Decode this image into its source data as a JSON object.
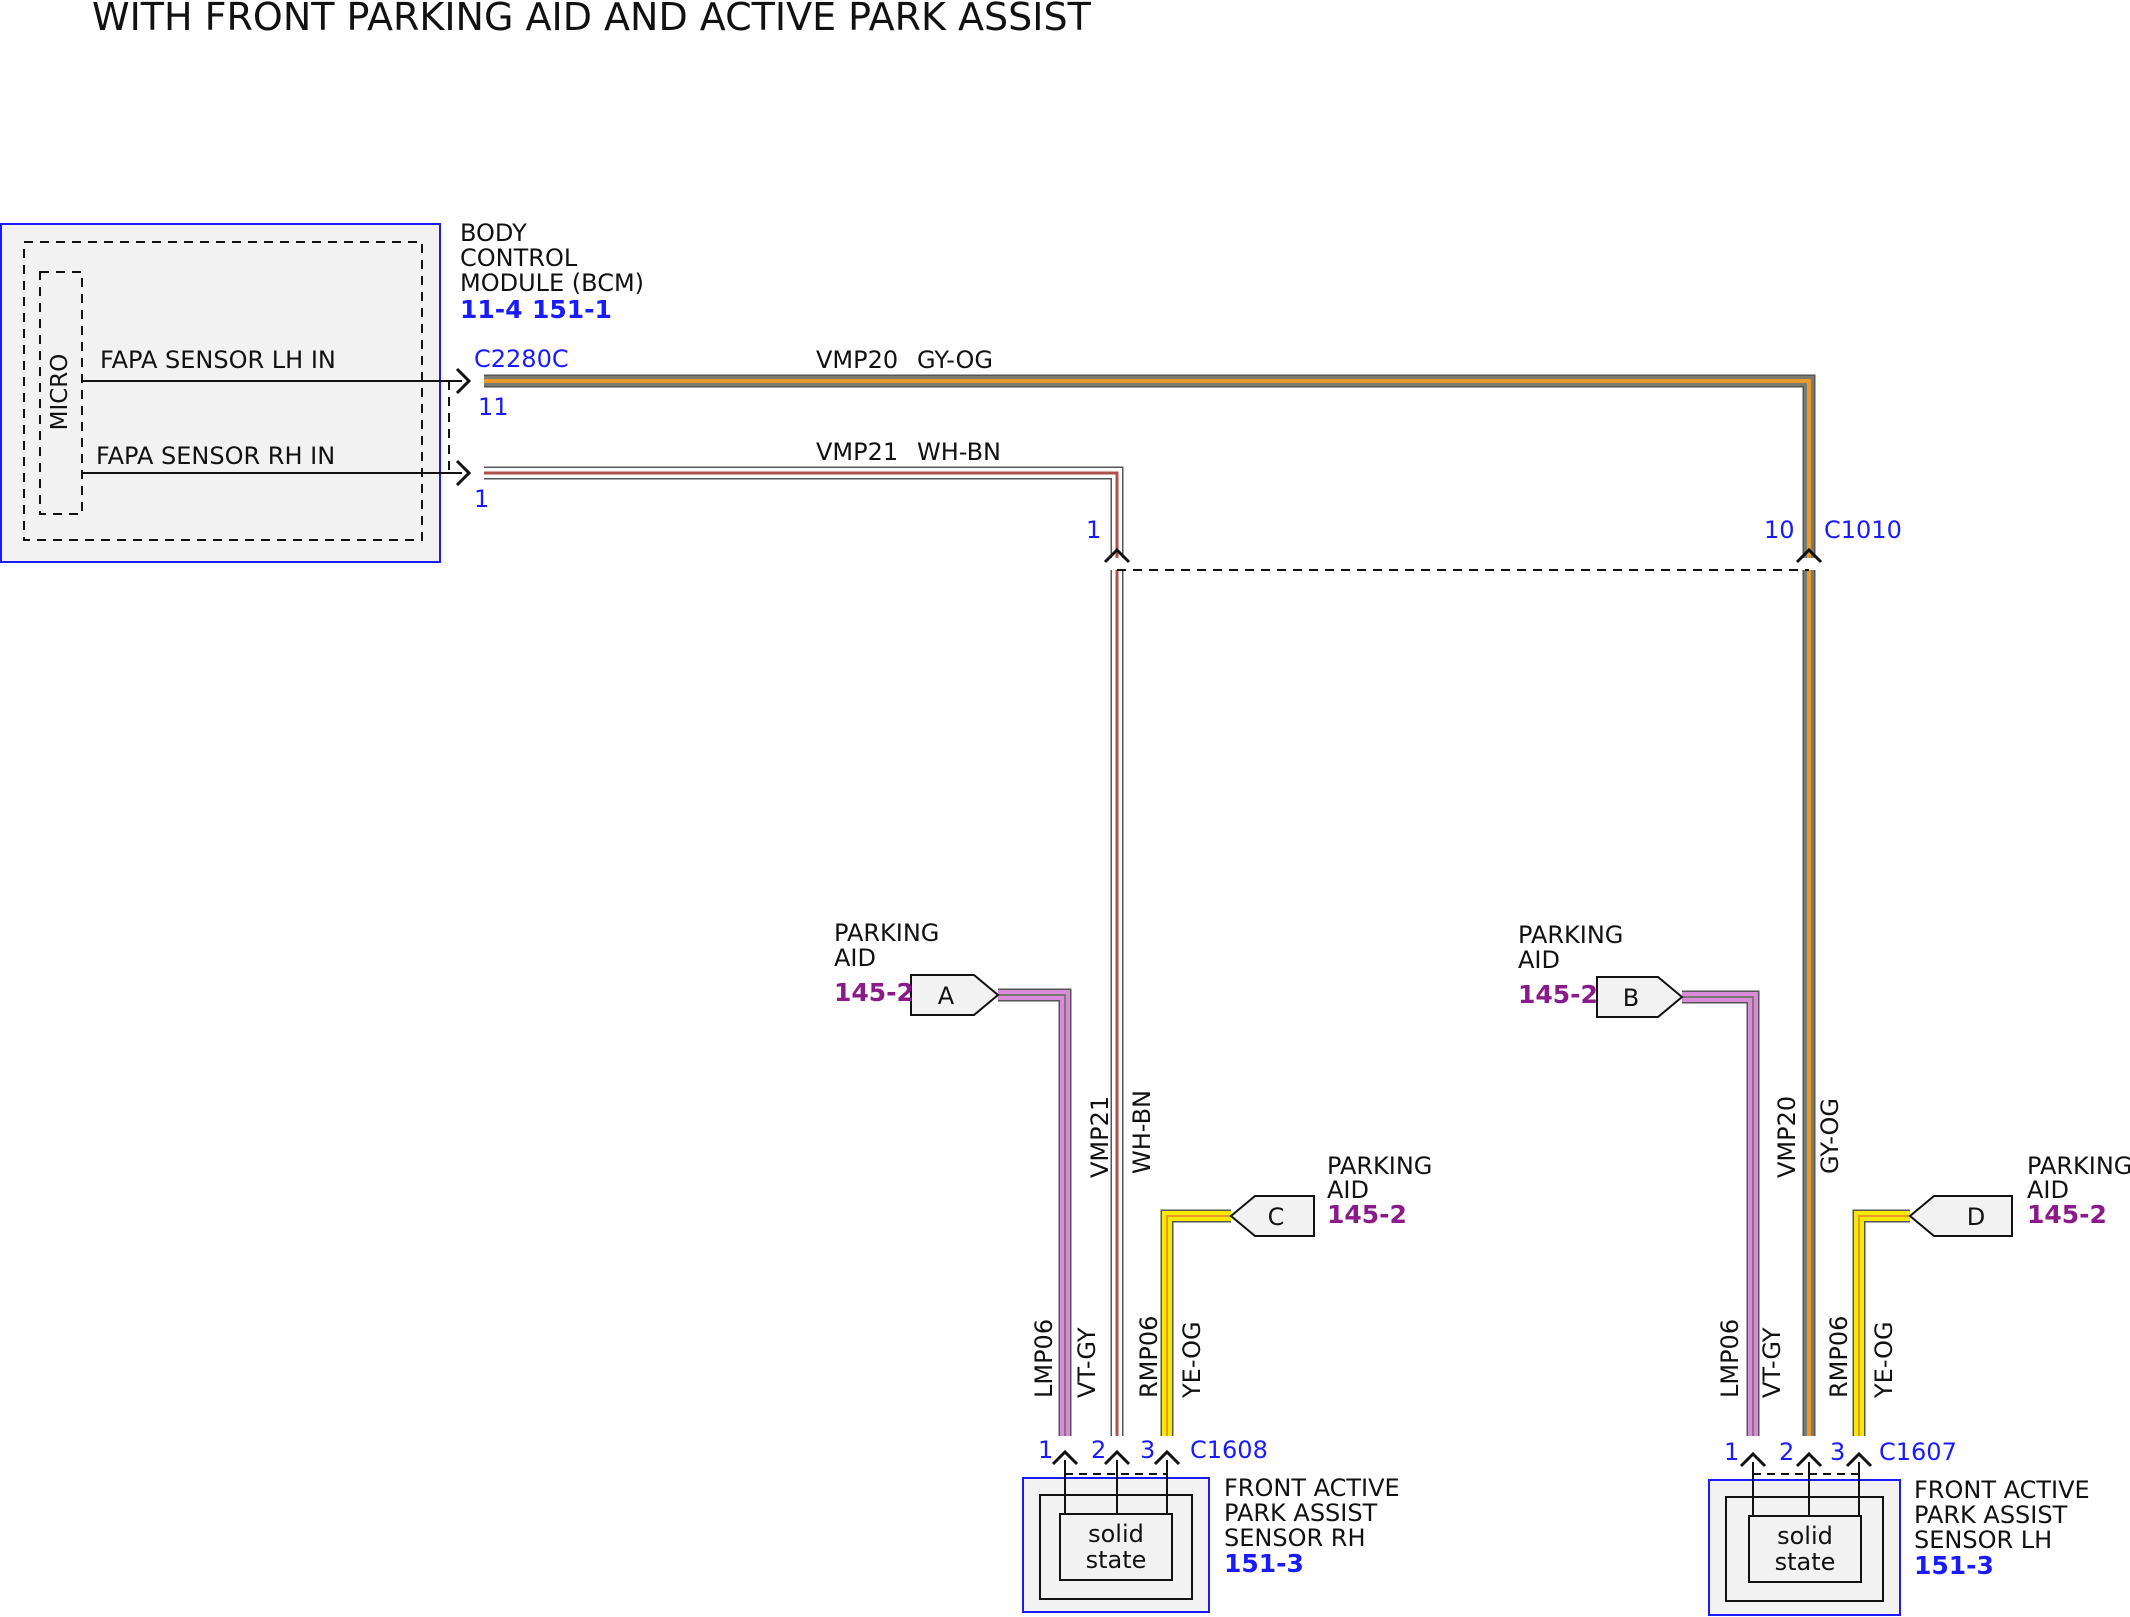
{
  "title": "WITH FRONT PARKING AID AND ACTIVE PARK ASSIST",
  "colors": {
    "module_border": "#1a1aff",
    "module_fill": "#f2f2f2",
    "ref_blue": "#1a1aff",
    "ref_purple": "#8a1a8a",
    "wire_gy": "#7a7a72",
    "wire_og": "#e89a2a",
    "wire_wh": "#ffffff",
    "wire_bn": "#b0504a",
    "wire_vt": "#d98ad9",
    "wire_ye": "#f5ea00"
  },
  "bcm": {
    "name_line1": "BODY",
    "name_line2": "CONTROL",
    "name_line3": "MODULE (BCM)",
    "ref1": "11-4",
    "ref2": "151-1",
    "micro_label": "MICRO",
    "pin_lh_label": "FAPA SENSOR LH IN",
    "pin_rh_label": "FAPA SENSOR RH IN",
    "connector": "C2280C",
    "pin_lh": "11",
    "pin_rh": "1"
  },
  "wires": {
    "vmp20": {
      "circuit": "VMP20",
      "color": "GY-OG"
    },
    "vmp21": {
      "circuit": "VMP21",
      "color": "WH-BN"
    },
    "lmp06": {
      "circuit": "LMP06",
      "color": "VT-GY"
    },
    "rmp06": {
      "circuit": "RMP06",
      "color": "YE-OG"
    }
  },
  "inline_connector": {
    "name": "C1010",
    "pin_vmp21": "1",
    "pin_vmp20": "10"
  },
  "parking_aid_refs": [
    {
      "id": "A",
      "line1": "PARKING",
      "line2": "AID",
      "ref": "145-2"
    },
    {
      "id": "B",
      "line1": "PARKING",
      "line2": "AID",
      "ref": "145-2"
    },
    {
      "id": "C",
      "line1": "PARKING",
      "line2": "AID",
      "ref": "145-2"
    },
    {
      "id": "D",
      "line1": "PARKING",
      "line2": "AID",
      "ref": "145-2"
    }
  ],
  "sensor_rh": {
    "connector": "C1608",
    "pins": [
      "1",
      "2",
      "3"
    ],
    "line1": "FRONT ACTIVE",
    "line2": "PARK ASSIST",
    "line3": "SENSOR RH",
    "ref": "151-3",
    "inner_line1": "solid",
    "inner_line2": "state"
  },
  "sensor_lh": {
    "connector": "C1607",
    "pins": [
      "1",
      "2",
      "3"
    ],
    "line1": "FRONT ACTIVE",
    "line2": "PARK ASSIST",
    "line3": "SENSOR LH",
    "ref": "151-3",
    "inner_line1": "solid",
    "inner_line2": "state"
  }
}
